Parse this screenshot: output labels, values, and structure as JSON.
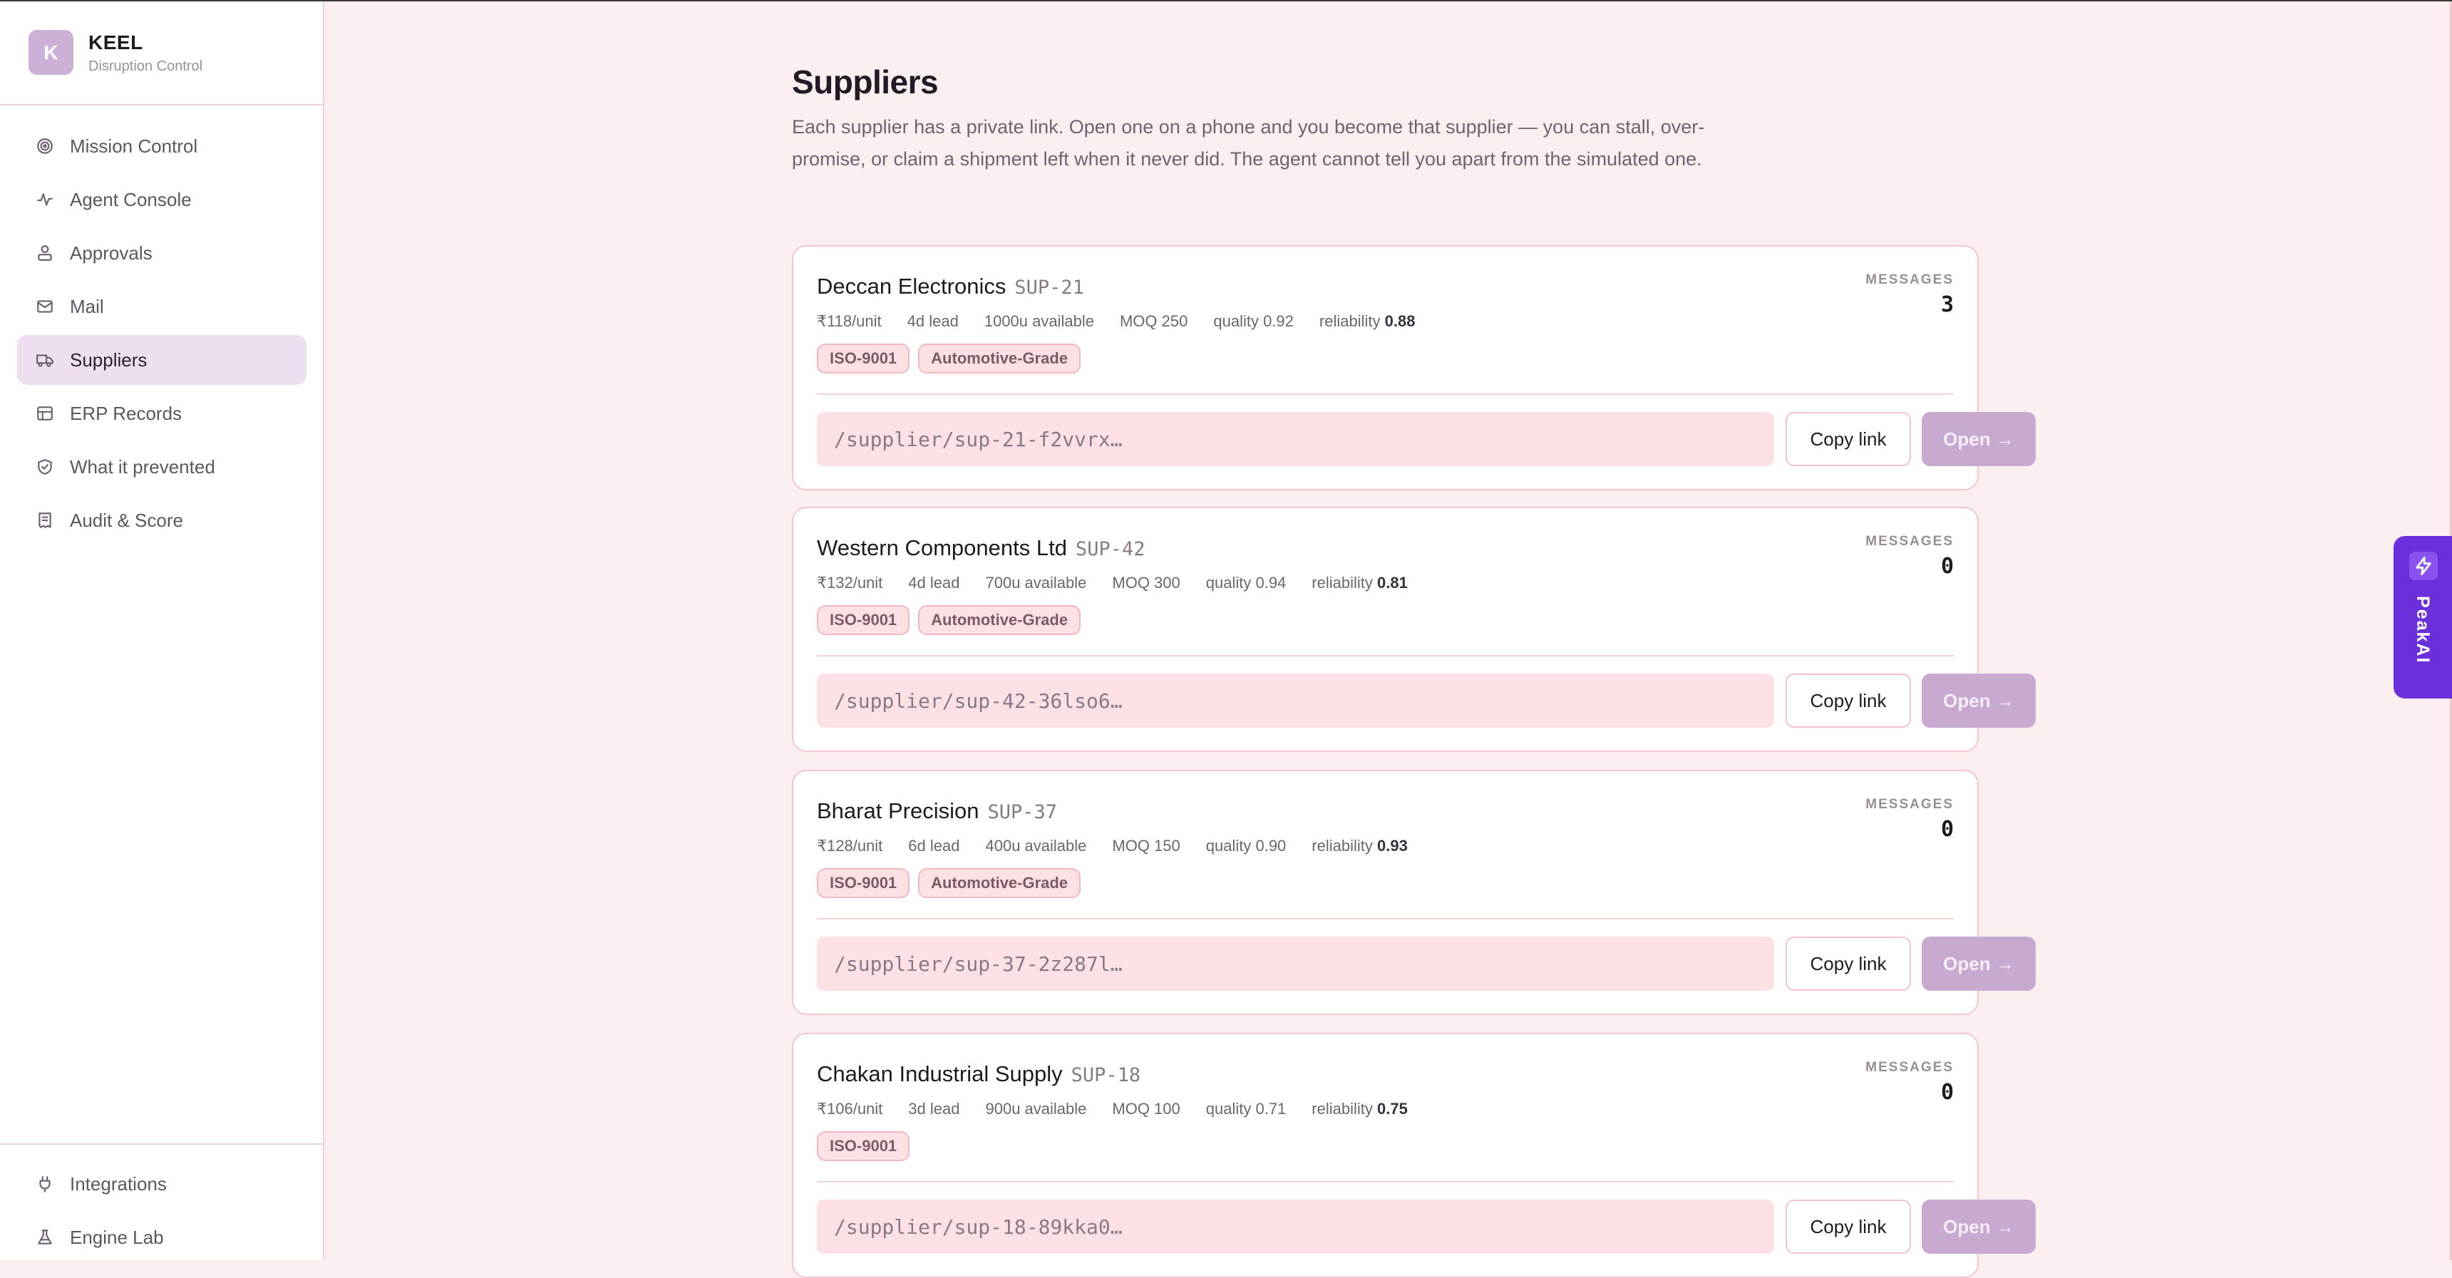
{
  "brand": {
    "logo_letter": "K",
    "name": "KEEL",
    "subtitle": "Disruption Control"
  },
  "sidebar": {
    "items": [
      {
        "label": "Mission Control",
        "icon": "target-icon"
      },
      {
        "label": "Agent Console",
        "icon": "activity-icon"
      },
      {
        "label": "Approvals",
        "icon": "user-stack-icon"
      },
      {
        "label": "Mail",
        "icon": "mail-icon"
      },
      {
        "label": "Suppliers",
        "icon": "truck-icon",
        "active": true
      },
      {
        "label": "ERP Records",
        "icon": "table-icon"
      },
      {
        "label": "What it prevented",
        "icon": "shield-check-icon"
      },
      {
        "label": "Audit & Score",
        "icon": "receipt-icon"
      }
    ],
    "bottom_items": [
      {
        "label": "Integrations",
        "icon": "plug-icon"
      },
      {
        "label": "Engine Lab",
        "icon": "flask-icon"
      }
    ]
  },
  "page": {
    "title": "Suppliers",
    "description": "Each supplier has a private link. Open one on a phone and you become that supplier — you can stall, over-promise, or claim a shipment left when it never did. The agent cannot tell you apart from the simulated one."
  },
  "labels": {
    "messages": "MESSAGES",
    "copy_link": "Copy link",
    "open": "Open →"
  },
  "suppliers": [
    {
      "name": "Deccan Electronics",
      "code": "SUP-21",
      "price": "₹118/unit",
      "lead": "4d lead",
      "available": "1000u available",
      "moq": "MOQ 250",
      "quality": "quality 0.92",
      "reliability_label": "reliability",
      "reliability": "0.88",
      "tags": [
        "ISO-9001",
        "Automotive-Grade"
      ],
      "messages": "3",
      "link": "/supplier/sup-21-f2vvrx…"
    },
    {
      "name": "Western Components Ltd",
      "code": "SUP-42",
      "price": "₹132/unit",
      "lead": "4d lead",
      "available": "700u available",
      "moq": "MOQ 300",
      "quality": "quality 0.94",
      "reliability_label": "reliability",
      "reliability": "0.81",
      "tags": [
        "ISO-9001",
        "Automotive-Grade"
      ],
      "messages": "0",
      "link": "/supplier/sup-42-36lso6…"
    },
    {
      "name": "Bharat Precision",
      "code": "SUP-37",
      "price": "₹128/unit",
      "lead": "6d lead",
      "available": "400u available",
      "moq": "MOQ 150",
      "quality": "quality 0.90",
      "reliability_label": "reliability",
      "reliability": "0.93",
      "tags": [
        "ISO-9001",
        "Automotive-Grade"
      ],
      "messages": "0",
      "link": "/supplier/sup-37-2z287l…"
    },
    {
      "name": "Chakan Industrial Supply",
      "code": "SUP-18",
      "price": "₹106/unit",
      "lead": "3d lead",
      "available": "900u available",
      "moq": "MOQ 100",
      "quality": "quality 0.71",
      "reliability_label": "reliability",
      "reliability": "0.75",
      "tags": [
        "ISO-9001"
      ],
      "messages": "0",
      "link": "/supplier/sup-18-89kka0…"
    }
  ],
  "assistant_tab": {
    "label": "PeakAI",
    "icon": "lightning-icon"
  },
  "colors": {
    "accent": "#6b2fdb",
    "background": "#fbeff0",
    "active_nav": "#eddff0",
    "tag_bg": "#fde1e4",
    "open_button": "#c8a9cf"
  }
}
